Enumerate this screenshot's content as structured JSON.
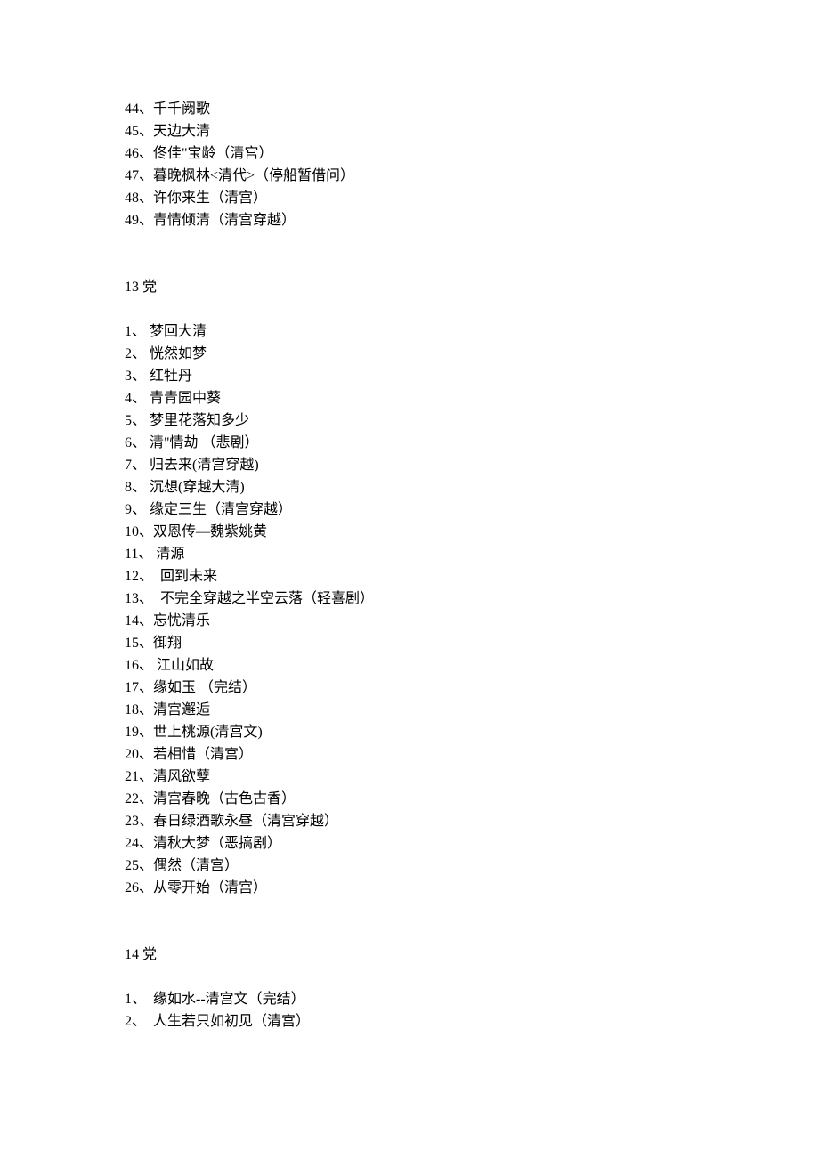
{
  "first_block": {
    "items": [
      "44、千千阙歌",
      "45、天边大清",
      "46、佟佳\"宝龄（清宫）",
      "47、暮晚枫林<清代>（停船暂借问）",
      "48、许你来生（清宫）",
      "49、青情倾清（清宫穿越）"
    ]
  },
  "section_13": {
    "title": "13 党",
    "items": [
      "1、 梦回大清",
      "2、 恍然如梦",
      "3、 红牡丹",
      "4、 青青园中葵",
      "5、 梦里花落知多少",
      "6、 清\"情劫 （悲剧）",
      "7、 归去来(清宫穿越)",
      "8、 沉想(穿越大清)",
      "9、 缘定三生（清宫穿越）",
      "10、双恩传—魏紫姚黄",
      "11、 清源",
      "12、  回到未来",
      "13、  不完全穿越之半空云落（轻喜剧）",
      "14、忘忧清乐",
      "15、御翔",
      "16、 江山如故",
      "17、缘如玉 （完结）",
      "18、清宫邂逅",
      "19、世上桃源(清宫文)",
      "20、若相惜（清宫）",
      "21、清风欲孽",
      "22、清宫春晚（古色古香）",
      "23、春日绿酒歌永昼（清宫穿越）",
      "24、清秋大梦（恶搞剧）",
      "25、偶然（清宫）",
      "26、从零开始（清宫）"
    ]
  },
  "section_14": {
    "title": "14 党",
    "items": [
      "1、  缘如水--清宫文（完结）",
      "2、  人生若只如初见（清宫）"
    ]
  }
}
